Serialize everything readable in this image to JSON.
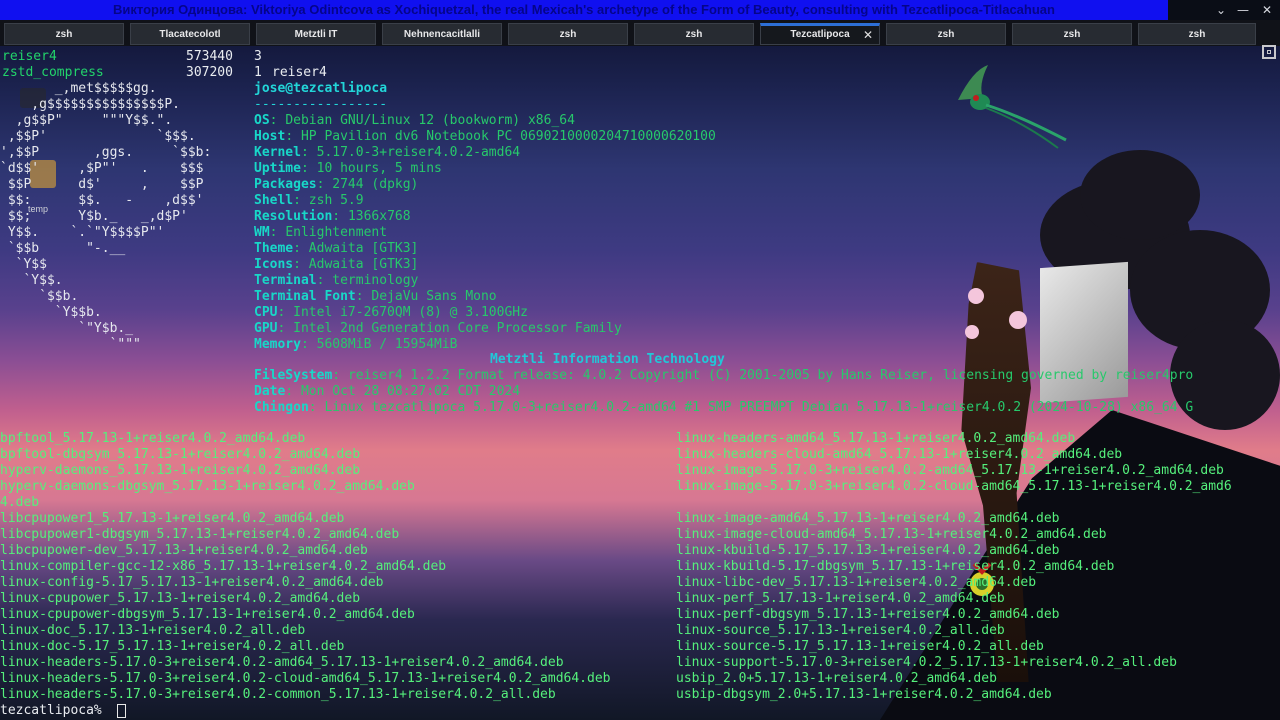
{
  "window": {
    "title": "Виктория Одинцова: Viktoriya Odintcova as Xochiquetzal, the real Mexicah's archetype of the Form of Beauty, consulting with Tezcatlipoca-Titlacahuan",
    "buttons": {
      "chevron": "⌄",
      "minimize": "—",
      "close": "✕"
    }
  },
  "tabs": [
    {
      "label": "zsh"
    },
    {
      "label": "Tlacatecolotl"
    },
    {
      "label": "Metztli IT"
    },
    {
      "label": "Nehnencacitlalli"
    },
    {
      "label": "zsh"
    },
    {
      "label": "zsh"
    },
    {
      "label": "Tezcatlipoca",
      "active": true,
      "close": "✕"
    },
    {
      "label": "zsh"
    },
    {
      "label": "zsh"
    },
    {
      "label": "zsh"
    }
  ],
  "desktop": {
    "icon_label": "temp"
  },
  "terminal": {
    "top_rows": [
      {
        "name": "reiser4",
        "size": "573440",
        "count": "3"
      },
      {
        "name": "zstd_compress",
        "size": "307200",
        "count": "1",
        "extra": "reiser4"
      }
    ],
    "ascii_logo": [
      "       _,met$$$$$gg.",
      "    ,g$$$$$$$$$$$$$$$P.",
      "  ,g$$P\"     \"\"\"Y$$.\".",
      " ,$$P'              `$$$.",
      "',$$P       ,ggs.     `$$b:",
      "`d$$'     ,$P\"'   .    $$$",
      " $$P      d$'     ,    $$P",
      " $$:      $$.   -    ,d$$'",
      " $$;      Y$b._   _,d$P'",
      " Y$$.    `.`\"Y$$$$P\"'",
      " `$$b      \"-.__",
      "  `Y$$",
      "   `Y$$.",
      "     `$$b.",
      "       `Y$$b.",
      "          `\"Y$b._",
      "              `\"\"\""
    ],
    "neofetch": {
      "user_host": "jose@tezcatlipoca",
      "separator": "-----------------",
      "fields": [
        {
          "label": "OS",
          "value": "Debian GNU/Linux 12 (bookworm) x86_64"
        },
        {
          "label": "Host",
          "value": "HP Pavilion dv6 Notebook PC 0690210000204710000620100"
        },
        {
          "label": "Kernel",
          "value": "5.17.0-3+reiser4.0.2-amd64"
        },
        {
          "label": "Uptime",
          "value": "10 hours, 5 mins"
        },
        {
          "label": "Packages",
          "value": "2744 (dpkg)"
        },
        {
          "label": "Shell",
          "value": "zsh 5.9"
        },
        {
          "label": "Resolution",
          "value": "1366x768"
        },
        {
          "label": "WM",
          "value": "Enlightenment"
        },
        {
          "label": "Theme",
          "value": "Adwaita [GTK3]"
        },
        {
          "label": "Icons",
          "value": "Adwaita [GTK3]"
        },
        {
          "label": "Terminal",
          "value": "terminology"
        },
        {
          "label": "Terminal Font",
          "value": "DejaVu Sans Mono"
        },
        {
          "label": "CPU",
          "value": "Intel i7-2670QM (8) @ 3.100GHz"
        },
        {
          "label": "GPU",
          "value": "Intel 2nd Generation Core Processor Family"
        },
        {
          "label": "Memory",
          "value": "5608MiB / 15954MiB"
        }
      ],
      "center_title": "Metztli Information Technology",
      "extra_fields": [
        {
          "label": "FileSystem",
          "value": "reiser4 1.2.2 Format release: 4.0.2 Copyright (C) 2001-2005 by Hans Reiser, licensing governed by reiser4pro"
        },
        {
          "label": "Date",
          "value": "Mon Oct 28 08:27:02 CDT 2024"
        },
        {
          "label": "Chingon",
          "value": "Linux tezcatlipoca 5.17.0-3+reiser4.0.2-amd64 #1 SMP PREEMPT Debian 5.17.13-1+reiser4.0.2 (2024-10-28) x86_64 G"
        }
      ]
    },
    "deb_left": [
      "bpftool_5.17.13-1+reiser4.0.2_amd64.deb",
      "bpftool-dbgsym_5.17.13-1+reiser4.0.2_amd64.deb",
      "hyperv-daemons_5.17.13-1+reiser4.0.2_amd64.deb",
      "hyperv-daemons-dbgsym_5.17.13-1+reiser4.0.2_amd64.deb",
      "4.deb",
      "libcpupower1_5.17.13-1+reiser4.0.2_amd64.deb",
      "libcpupower1-dbgsym_5.17.13-1+reiser4.0.2_amd64.deb",
      "libcpupower-dev_5.17.13-1+reiser4.0.2_amd64.deb",
      "linux-compiler-gcc-12-x86_5.17.13-1+reiser4.0.2_amd64.deb",
      "linux-config-5.17_5.17.13-1+reiser4.0.2_amd64.deb",
      "linux-cpupower_5.17.13-1+reiser4.0.2_amd64.deb",
      "linux-cpupower-dbgsym_5.17.13-1+reiser4.0.2_amd64.deb",
      "linux-doc_5.17.13-1+reiser4.0.2_all.deb",
      "linux-doc-5.17_5.17.13-1+reiser4.0.2_all.deb",
      "linux-headers-5.17.0-3+reiser4.0.2-amd64_5.17.13-1+reiser4.0.2_amd64.deb",
      "linux-headers-5.17.0-3+reiser4.0.2-cloud-amd64_5.17.13-1+reiser4.0.2_amd64.deb",
      "linux-headers-5.17.0-3+reiser4.0.2-common_5.17.13-1+reiser4.0.2_all.deb"
    ],
    "deb_right": [
      "linux-headers-amd64_5.17.13-1+reiser4.0.2_amd64.deb",
      "linux-headers-cloud-amd64_5.17.13-1+reiser4.0.2_amd64.deb",
      "linux-image-5.17.0-3+reiser4.0.2-amd64_5.17.13-1+reiser4.0.2_amd64.deb",
      "linux-image-5.17.0-3+reiser4.0.2-cloud-amd64_5.17.13-1+reiser4.0.2_amd6",
      "",
      "linux-image-amd64_5.17.13-1+reiser4.0.2_amd64.deb",
      "linux-image-cloud-amd64_5.17.13-1+reiser4.0.2_amd64.deb",
      "linux-kbuild-5.17_5.17.13-1+reiser4.0.2_amd64.deb",
      "linux-kbuild-5.17-dbgsym_5.17.13-1+reiser4.0.2_amd64.deb",
      "linux-libc-dev_5.17.13-1+reiser4.0.2_amd64.deb",
      "linux-perf_5.17.13-1+reiser4.0.2_amd64.deb",
      "linux-perf-dbgsym_5.17.13-1+reiser4.0.2_amd64.deb",
      "linux-source_5.17.13-1+reiser4.0.2_all.deb",
      "linux-source-5.17_5.17.13-1+reiser4.0.2_all.deb",
      "linux-support-5.17.0-3+reiser4.0.2_5.17.13-1+reiser4.0.2_all.deb",
      "usbip_2.0+5.17.13-1+reiser4.0.2_amd64.deb",
      "usbip-dbgsym_2.0+5.17.13-1+reiser4.0.2_amd64.deb"
    ],
    "prompt": "tezcatlipoca%"
  },
  "colors": {
    "accent": "#2d6fd6",
    "title_bar": "#1010f0",
    "prompt": "#22d6d8",
    "deb_files": "#55f07c"
  }
}
